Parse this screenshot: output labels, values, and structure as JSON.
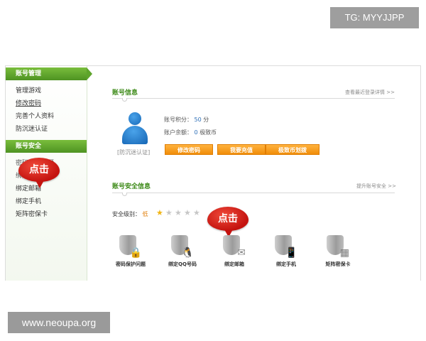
{
  "watermarks": {
    "tg": "TG: MYYJJPP",
    "site": "www.neoupa.org"
  },
  "sidebar": {
    "account_management": {
      "title": "账号管理",
      "items": [
        "管理游戏",
        "修改密码",
        "完善个人资料",
        "防沉迷认证"
      ]
    },
    "account_security": {
      "title": "账号安全",
      "items": [
        "密码保护问题",
        "绑定QQ号码",
        "绑定邮箱",
        "绑定手机",
        "矩阵密保卡"
      ]
    }
  },
  "click_bubbles": {
    "sidebar": "点击",
    "main": "点击"
  },
  "account_info": {
    "title": "账号信息",
    "link": "查看最近登录详情 >>",
    "avatar_caption": "[防沉迷认证]",
    "points_label": "账号积分：",
    "points_value": "50",
    "points_unit": "分",
    "balance_label": "账户余额：",
    "balance_value": "0",
    "balance_unit": "极致币",
    "buttons": [
      "修改密码",
      "我要充值",
      "极致币划拨"
    ]
  },
  "security_info": {
    "title": "账号安全信息",
    "link": "提升账号安全 >>",
    "level_label": "安全级别：",
    "level_value": "低",
    "stars_filled": 1,
    "stars_total": 5,
    "items": [
      {
        "label": "密码保护问题",
        "icon": "lock-shield-icon"
      },
      {
        "label": "绑定QQ号码",
        "icon": "qq-penguin-shield-icon"
      },
      {
        "label": "绑定邮箱",
        "icon": "envelope-shield-icon"
      },
      {
        "label": "绑定手机",
        "icon": "phone-shield-icon"
      },
      {
        "label": "矩阵密保卡",
        "icon": "card-shield-icon"
      }
    ]
  },
  "colors": {
    "sidebar_header": "#5ea42b",
    "section_title": "#3d8a18",
    "button_orange": "#f5a020",
    "bubble_red": "#d91c14",
    "avatar_blue": "#1f78c8",
    "star_on": "#f1b514"
  }
}
